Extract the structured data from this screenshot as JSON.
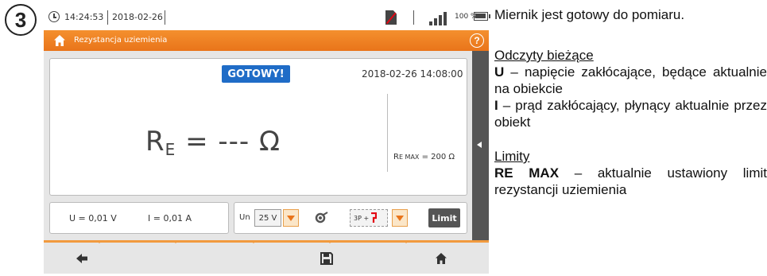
{
  "step": {
    "number": "3"
  },
  "status_bar": {
    "time": "14:24:53",
    "date": "2018-02-26",
    "battery": "100 %",
    "icons": [
      "clock-icon",
      "sd-card-disabled-icon",
      "signal-strength-icon",
      "battery-icon"
    ]
  },
  "title_bar": {
    "title": "Rezystancja uziemienia",
    "home_icon": "home-icon",
    "help": "?"
  },
  "result": {
    "status": "GOTOWY!",
    "timestamp": "2018-02-26 14:08:00",
    "re_symbol": "R",
    "re_sub": "E",
    "re_value": " = --- Ω",
    "limit_prefix": "R",
    "limit_sub": "E MAX",
    "limit_value": " = 200 Ω"
  },
  "readings": {
    "u": "U = 0,01 V",
    "i": "I = 0,01 A"
  },
  "settings": {
    "un_label": "Un",
    "un_value": "25 V",
    "mode_value": "3P +",
    "limit_label": "Limit"
  },
  "bottom_bar": {
    "buttons": [
      "back-icon",
      "save-icon",
      "home-icon"
    ]
  },
  "colors": {
    "accent_orange": "#e9741a",
    "badge_blue": "#1f6cc7",
    "side_tab": "#555555",
    "screen_bg": "#e6e6e6"
  },
  "description": {
    "intro": "Miernik jest gotowy do pomiaru.",
    "readings_heading": "Odczyty bieżące",
    "u_term": "U",
    "u_desc": " – napięcie zakłócające, będące aktualnie na obiekcie",
    "i_term": "I",
    "i_desc": " – prąd zakłócający, płynący aktualnie przez obiekt",
    "limits_heading": "Limity",
    "remax_term": "RE MAX",
    "remax_desc": " – aktualnie ustawiony limit rezystancji uziemienia"
  }
}
